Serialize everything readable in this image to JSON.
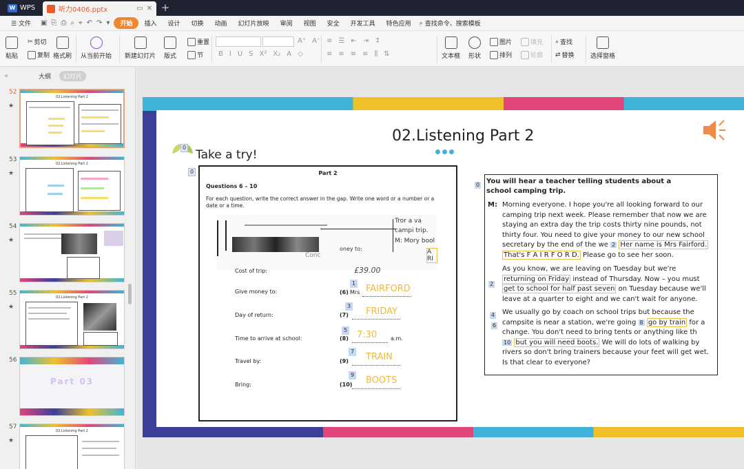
{
  "titlebar": {
    "app_tab": "WPS",
    "doc_tab": "听力0406.pptx"
  },
  "menu": {
    "file": "文件",
    "items": [
      "开始",
      "插入",
      "设计",
      "切换",
      "动画",
      "幻灯片放映",
      "审阅",
      "视图",
      "安全",
      "开发工具",
      "特色应用"
    ],
    "search": "查找命令、搜索模板"
  },
  "ribbon": {
    "paste": "粘贴",
    "cut": "剪切",
    "copy": "复制",
    "format_painter": "格式刷",
    "play_from_current": "从当前开始",
    "new_slide": "新建幻灯片",
    "layout": "版式",
    "section": "节",
    "reset": "重置",
    "text_box": "文本框",
    "shape": "形状",
    "picture": "图片",
    "arrange": "排列",
    "fill": "填充",
    "outline": "轮廓",
    "find": "查找",
    "replace": "替换",
    "select_pane": "选择窗格"
  },
  "left_panel": {
    "outline_tab": "大纲",
    "slides_tab": "幻灯片",
    "slides": [
      {
        "num": "52",
        "title": "02.Listening Part 2"
      },
      {
        "num": "53",
        "title": "02.Listening Part 2"
      },
      {
        "num": "54",
        "title": ""
      },
      {
        "num": "55",
        "title": "02.Listening Part 2"
      },
      {
        "num": "56",
        "title": "Part 03"
      },
      {
        "num": "57",
        "title": "02.Listening Part 2"
      }
    ]
  },
  "slide": {
    "title": "02.Listening Part 2",
    "take_try": "Take a try!",
    "marker": "0",
    "sheet": {
      "part": "Part 2",
      "questions": "Questions 6 – 10",
      "instruction": "For each question, write the correct answer in the gap. Write one word or a number or a date or a time.",
      "rows": [
        {
          "label": "Cost of trip:",
          "num": "",
          "prefix": "",
          "answer": "£39.00",
          "badge": ""
        },
        {
          "label": "Give money to:",
          "num": "(6)",
          "prefix": "Mrs",
          "answer": "FAIRFORD",
          "badge": "1"
        },
        {
          "label": "Day of return:",
          "num": "(7)",
          "prefix": "",
          "answer": "FRIDAY",
          "badge": "3"
        },
        {
          "label": "Time to arrive at school:",
          "num": "(8)",
          "prefix": "a.m.",
          "answer": "7:30",
          "badge": "5"
        },
        {
          "label": "Travel by:",
          "num": "(9)",
          "prefix": "",
          "answer": "TRAIN",
          "badge": "7"
        },
        {
          "label": "Bring:",
          "num": "(10)",
          "prefix": "",
          "answer": "BOOTS",
          "badge": "9"
        }
      ]
    },
    "transcript": {
      "heading": "You will hear a teacher telling students about a school camping trip.",
      "speaker": "M:",
      "p1a": "Morning everyone. I hope you're all looking forward to our camping trip next week. Please remember that now we are staying an extra day the trip costs thirty nine pounds, not thirty four. You need to give your money to our new school secretary by the end of the we",
      "p1_badge": "2",
      "p1b": "Her name is Mrs Fairford.",
      "p1c": "That's F A I R F O R D.",
      "p1d": "Please go to see her soon.",
      "p2a": "As you know, we are leaving on Tuesday but we're",
      "p2b": "returning on Friday",
      "p2c": "instead of Thursday. Now – you must",
      "p2d": "get to school for half past seven",
      "p2e": "on Tuesday because we'll leave at a quarter to eight and we can't wait for anyone.",
      "p3a": "We usually go by coach on school trips but because the campsite is near a station, we're going",
      "p3b": "go by train",
      "p3c": "for a change. You don't need to bring tents or anything like th",
      "p3d": "but you will need boots.",
      "p3e": "We will do lots of walking by rivers so don't bring trainers because your feet will get wet. Is that clear to everyone?",
      "badges": [
        "0",
        "2",
        "4",
        "6",
        "8",
        "10"
      ]
    },
    "garbled_text": [
      "Tror a va",
      "campi trip.",
      "M: Mory bool",
      "A RI",
      "oney to:",
      "Conc"
    ]
  },
  "colors": {
    "accent_orange": "#f0872e",
    "answer_yellow": "#f0b93a",
    "brand_blue": "#3fb4d8",
    "brand_pink": "#e0457b",
    "brand_navy": "#3a3f9a",
    "brand_yellow": "#f0c02a"
  }
}
